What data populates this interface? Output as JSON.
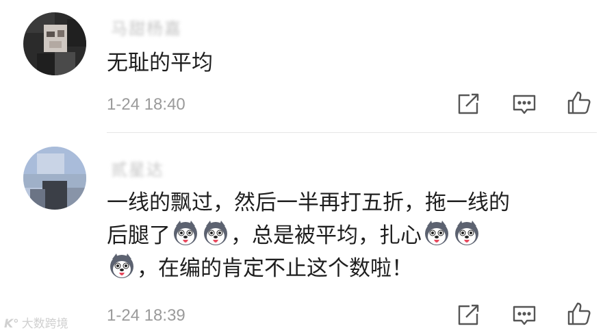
{
  "comments": [
    {
      "username": "马甜杨嘉",
      "text": "无耻的平均",
      "time": "1-24 18:40"
    },
    {
      "username": "贰星达",
      "text_line1": "一线的飘过，然后一半再打五折，拖一线的",
      "text_line2_a": "后腿了",
      "text_line2_b": "，总是被平均，扎心",
      "text_line3": "，在编的肯定不止这个数啦！",
      "time": "1-24 18:39"
    }
  ],
  "icons": {
    "share": "share-icon",
    "reply": "comment-icon",
    "like": "thumbs-up-icon",
    "emoji": "husky-dog-emoji"
  },
  "watermark": {
    "logo": "K°",
    "text": "大数跨境"
  }
}
